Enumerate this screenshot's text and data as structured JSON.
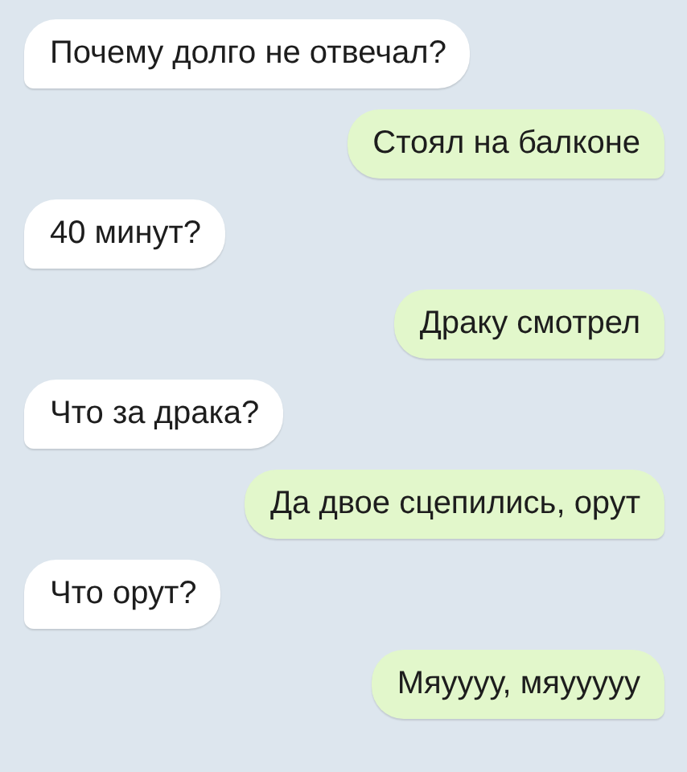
{
  "messages": [
    {
      "kind": "incoming",
      "text": "Почему долго не отвечал?"
    },
    {
      "kind": "outgoing",
      "text": "Стоял на балконе"
    },
    {
      "kind": "incoming",
      "text": "40 минут?"
    },
    {
      "kind": "outgoing",
      "text": "Драку смотрел"
    },
    {
      "kind": "incoming",
      "text": "Что за драка?"
    },
    {
      "kind": "outgoing",
      "text": "Да двое сцепились, орут"
    },
    {
      "kind": "incoming",
      "text": "Что орут?"
    },
    {
      "kind": "outgoing",
      "text": "Мяуууу, мяууууу"
    }
  ]
}
